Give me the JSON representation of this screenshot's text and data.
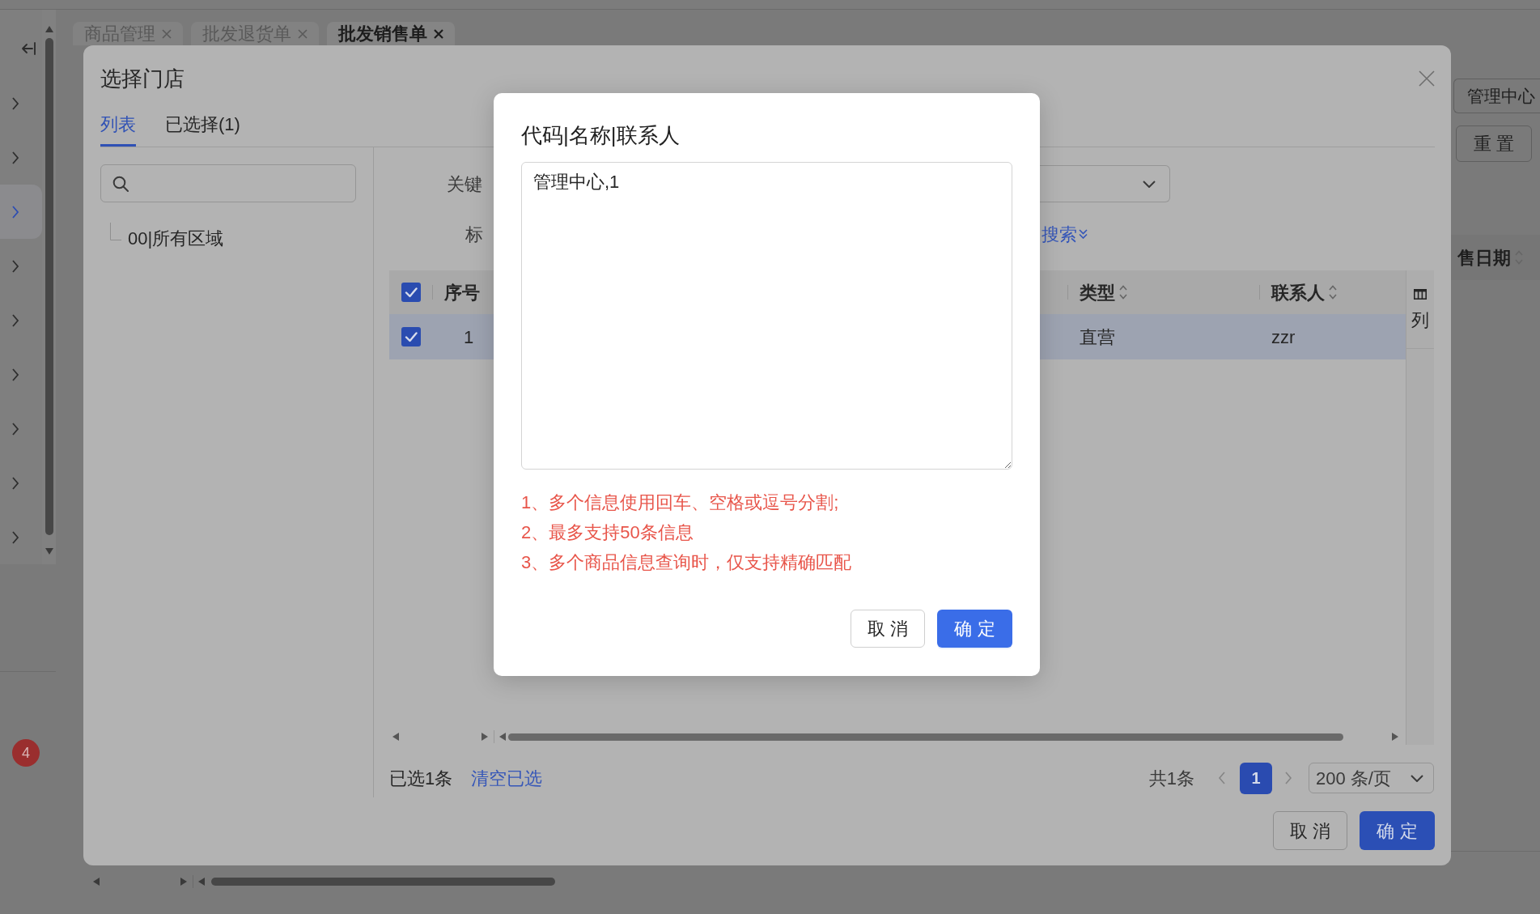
{
  "app": {
    "tabs": [
      {
        "label": "商品管理",
        "selected": false
      },
      {
        "label": "批发退货单",
        "selected": false
      },
      {
        "label": "批发销售单",
        "selected": true
      }
    ],
    "sidebar": {
      "items": [
        {
          "selected": false
        },
        {
          "selected": false
        },
        {
          "selected": true
        },
        {
          "selected": false
        },
        {
          "selected": false
        },
        {
          "selected": false
        },
        {
          "selected": false
        },
        {
          "selected": false
        },
        {
          "selected": false
        }
      ],
      "badge": "4"
    },
    "toolbar": {
      "store_select": "管理中心",
      "reset_button": "重 置"
    },
    "table": {
      "columns": [
        {
          "label": "售日期",
          "sortable": true
        }
      ]
    }
  },
  "store_dialog": {
    "title": "选择门店",
    "tabs": [
      {
        "label": "列表",
        "selected": true
      },
      {
        "label": "已选择(1)",
        "selected": false
      }
    ],
    "tree": [
      {
        "label": "00|所有区域"
      }
    ],
    "filters": [
      {
        "label": "关键",
        "kind": "select"
      },
      {
        "label": "标",
        "kind": "tags"
      }
    ],
    "advanced_search": "搜索",
    "table": {
      "all_checked": true,
      "columns": [
        {
          "label": "序号",
          "sortable": false
        },
        {
          "label": "类型",
          "sortable": true
        },
        {
          "label": "联系人",
          "sortable": true
        }
      ],
      "rows": [
        {
          "checked": true,
          "selected": true,
          "cells": [
            "1",
            "直营",
            "zzr"
          ]
        }
      ]
    },
    "column_settings": "列",
    "footer": {
      "selected_count": "已选1条",
      "clear_link": "清空已选",
      "total": "共1条",
      "pages": [
        {
          "label": "1",
          "selected": true
        }
      ],
      "page_size": "200 条/页"
    },
    "buttons": [
      {
        "label": "取 消",
        "kind": "default"
      },
      {
        "label": "确 定",
        "kind": "primary"
      }
    ]
  },
  "input_dialog": {
    "title": "代码|名称|联系人",
    "textarea": {
      "value": "管理中心,1"
    },
    "hints": [
      "1、多个信息使用回车、空格或逗号分割;",
      "2、最多支持50条信息",
      "3、多个商品信息查询时，仅支持精确匹配"
    ],
    "buttons": [
      {
        "label": "取 消",
        "kind": "default"
      },
      {
        "label": "确 定",
        "kind": "primary"
      }
    ]
  }
}
